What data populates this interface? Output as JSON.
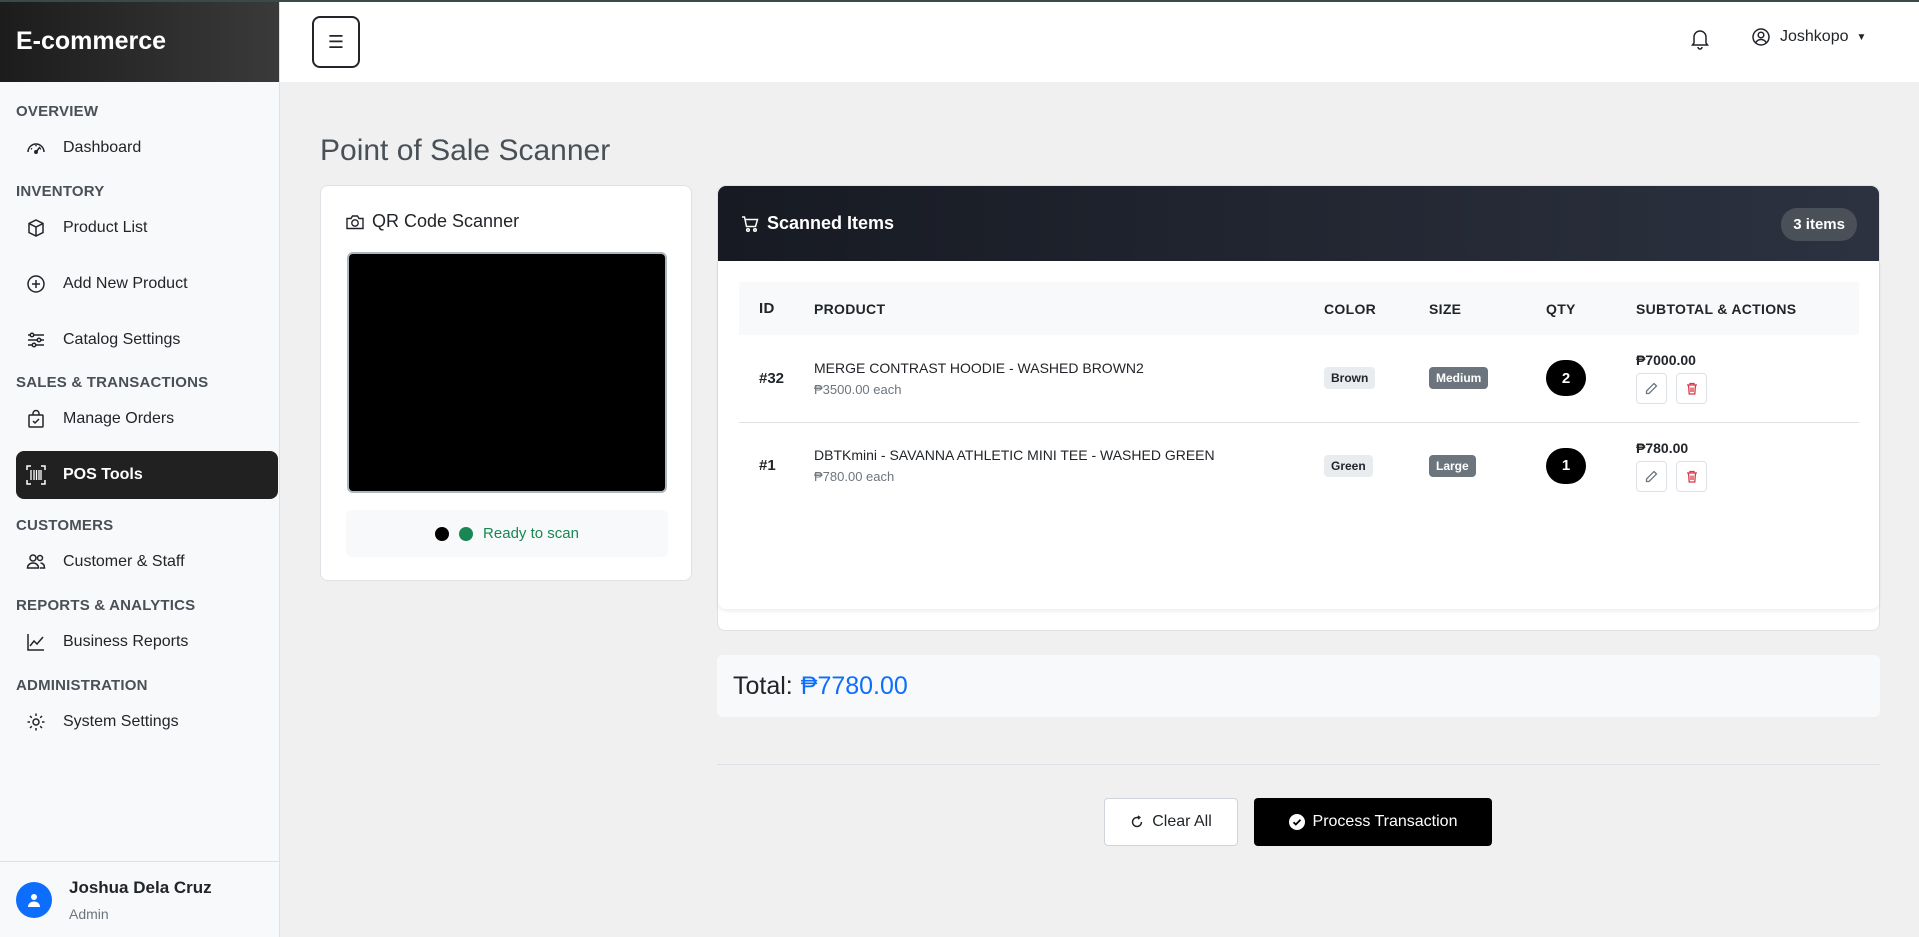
{
  "sidebar": {
    "brand": "E-commerce",
    "sections": [
      {
        "title": "OVERVIEW",
        "items": [
          {
            "label": "Dashboard",
            "icon": "speedometer-icon"
          }
        ]
      },
      {
        "title": "INVENTORY",
        "items": [
          {
            "label": "Product List",
            "icon": "box-icon"
          },
          {
            "label": "Add New Product",
            "icon": "plus-circle-icon"
          },
          {
            "label": "Catalog Settings",
            "icon": "sliders-icon"
          }
        ]
      },
      {
        "title": "SALES & TRANSACTIONS",
        "items": [
          {
            "label": "Manage Orders",
            "icon": "bag-check-icon"
          },
          {
            "label": "POS Tools",
            "icon": "barcode-scan-icon",
            "active": true
          }
        ]
      },
      {
        "title": "CUSTOMERS",
        "items": [
          {
            "label": "Customer & Staff",
            "icon": "people-icon"
          }
        ]
      },
      {
        "title": "REPORTS & ANALYTICS",
        "items": [
          {
            "label": "Business Reports",
            "icon": "graph-icon"
          }
        ]
      },
      {
        "title": "ADMINISTRATION",
        "items": [
          {
            "label": "System Settings",
            "icon": "gear-icon"
          }
        ]
      }
    ],
    "user": {
      "name": "Joshua Dela Cruz",
      "role": "Admin"
    }
  },
  "topbar": {
    "menu_icon": "☰",
    "username": "Joshkopo"
  },
  "main": {
    "title": "Point of Sale Scanner",
    "scanner": {
      "title": "QR Code Scanner",
      "status": "Ready to scan"
    },
    "items": {
      "title": "Scanned Items",
      "count": "3 items",
      "columns": [
        "ID",
        "PRODUCT",
        "COLOR",
        "SIZE",
        "QTY",
        "SUBTOTAL & ACTIONS"
      ],
      "rows": [
        {
          "id": "#32",
          "name": "MERGE CONTRAST HOODIE - WASHED BROWN2",
          "price": "₱3500.00 each",
          "color": "Brown",
          "size": "Medium",
          "qty": "2",
          "subtotal": "₱7000.00"
        },
        {
          "id": "#1",
          "name": "DBTKmini - SAVANNA ATHLETIC MINI TEE - WASHED GREEN",
          "price": "₱780.00 each",
          "color": "Green",
          "size": "Large",
          "qty": "1",
          "subtotal": "₱780.00"
        }
      ]
    },
    "total": {
      "label": "Total:",
      "amount": "₱7780.00"
    },
    "buttons": {
      "clear": "Clear All",
      "process": "Process Transaction"
    }
  },
  "colors": {
    "accent": "#0d6efd",
    "success": "#198754",
    "danger": "#dc3545",
    "dark": "#212121"
  }
}
